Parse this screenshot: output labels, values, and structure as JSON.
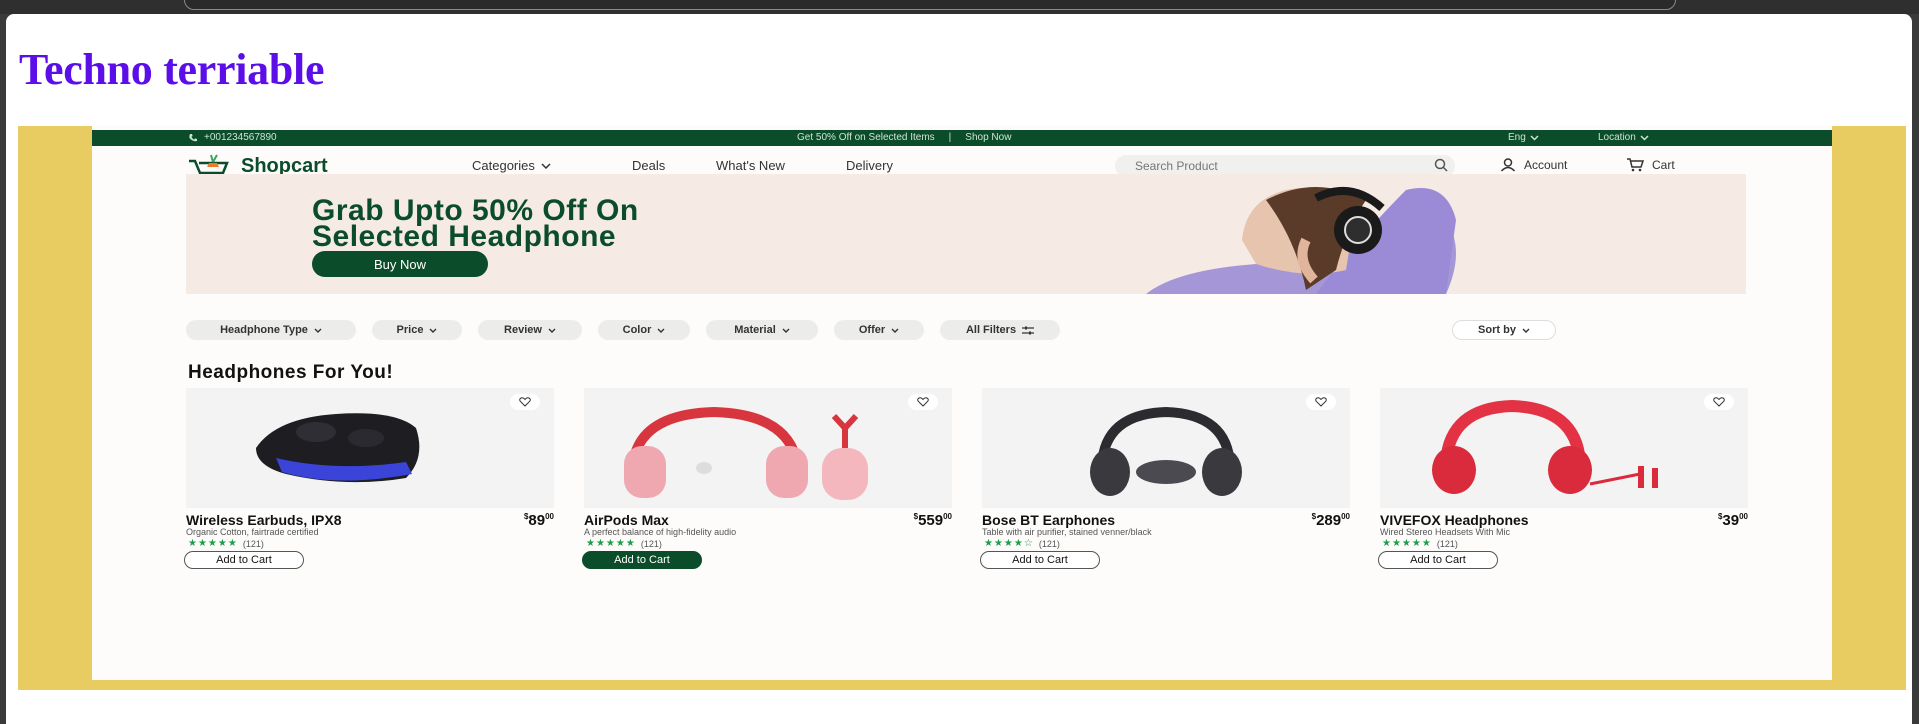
{
  "page": {
    "title": "Techno terriable"
  },
  "topbar": {
    "phone": "+001234567890",
    "promo": "Get 50% Off on Selected Items",
    "separator": "|",
    "shop_now": "Shop Now",
    "language": "Eng",
    "location": "Location"
  },
  "nav": {
    "logo": "Shopcart",
    "categories": "Categories",
    "deals": "Deals",
    "whats_new": "What's New",
    "delivery": "Delivery",
    "search_placeholder": "Search Product",
    "account": "Account",
    "cart": "Cart"
  },
  "hero": {
    "line1": "Grab Upto 50% Off On",
    "line2": "Selected Headphone",
    "button": "Buy Now"
  },
  "filters": {
    "chips": [
      "Headphone Type",
      "Price",
      "Review",
      "Color",
      "Material",
      "Offer"
    ],
    "all_filters": "All Filters",
    "sort": "Sort by"
  },
  "section_title": "Headphones For You!",
  "products": [
    {
      "name": "Wireless Earbuds, IPX8",
      "price": "89",
      "cents": "00",
      "currency": "$",
      "desc": "Organic Cotton, fairtrade certified",
      "rating_count": "(121)",
      "stars": "★★★★★",
      "button": "Add to Cart",
      "active": false
    },
    {
      "name": "AirPods Max",
      "price": "559",
      "cents": "00",
      "currency": "$",
      "desc": "A perfect balance of high-fidelity audio",
      "rating_count": "(121)",
      "stars": "★★★★★",
      "button": "Add to Cart",
      "active": true
    },
    {
      "name": "Bose BT Earphones",
      "price": "289",
      "cents": "00",
      "currency": "$",
      "desc": "Table with air purifier, stained venner/black",
      "rating_count": "(121)",
      "stars": "★★★★☆",
      "button": "Add to Cart",
      "active": false
    },
    {
      "name": "VIVEFOX Headphones",
      "price": "39",
      "cents": "00",
      "currency": "$",
      "desc": "Wired Stereo Headsets With Mic",
      "rating_count": "(121)",
      "stars": "★★★★★",
      "button": "Add to Cart",
      "active": false
    }
  ],
  "colors": {
    "brand_green": "#0b4d2a",
    "title_purple": "#5b0ee8",
    "frame_yellow": "#e8cc62",
    "hero_bg": "#f6ebe4",
    "star_green": "#1f9d4a"
  }
}
